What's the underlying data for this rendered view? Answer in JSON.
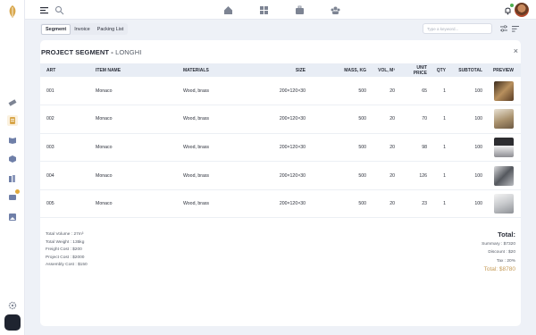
{
  "tabs": [
    "Segment",
    "Invoice",
    "Packing List"
  ],
  "search": {
    "placeholder": "Type a keyword..."
  },
  "card": {
    "title": "PROJECT SEGMENT -",
    "subtitle": "LONGHI",
    "close": "×"
  },
  "table": {
    "headers": [
      "ART",
      "ITEM NAME",
      "MATERIALS",
      "SIZE",
      "MASS, KG",
      "VOL, M³",
      "UNIT PRICE",
      "QTY",
      "SUBTOTAL",
      "PREVIEW"
    ],
    "rows": [
      [
        "001",
        "Monaco",
        "Wood, brass",
        "200×120×30",
        "500",
        "20",
        "65",
        "1",
        "100"
      ],
      [
        "002",
        "Monaco",
        "Wood, brass",
        "200×120×30",
        "500",
        "20",
        "70",
        "1",
        "100"
      ],
      [
        "003",
        "Monaco",
        "Wood, brass",
        "200×120×30",
        "500",
        "20",
        "98",
        "1",
        "100"
      ],
      [
        "004",
        "Monaco",
        "Wood, brass",
        "200×120×30",
        "500",
        "20",
        "126",
        "1",
        "100"
      ],
      [
        "005",
        "Monaco",
        "Wood, brass",
        "200×120×30",
        "500",
        "20",
        "23",
        "1",
        "100"
      ]
    ]
  },
  "summary_left": [
    "Total Volume : 27m³",
    "Total Weight : 135kg",
    "Freight Cost : $200",
    "Project Cost : $2000",
    "Assembly Cost : $150"
  ],
  "summary_right": {
    "heading": "Total:",
    "summary": "Summary : $7320",
    "discount": "Discount : $20",
    "tax": "Tax : 20%",
    "total": "Total: $8780"
  },
  "colors": {
    "accent": "#c59a55",
    "header_bg": "#e8edf5",
    "page_bg": "#eef1f7"
  },
  "icons": {
    "rail": [
      "logo-icon",
      "ruler-icon",
      "document-icon",
      "book-icon",
      "cube-icon",
      "books-icon",
      "chat-icon",
      "image-icon",
      "settings-icon"
    ],
    "topbar": [
      "menu-icon",
      "search-icon",
      "home-icon",
      "grid-icon",
      "briefcase-icon",
      "team-icon",
      "bell-icon"
    ]
  }
}
